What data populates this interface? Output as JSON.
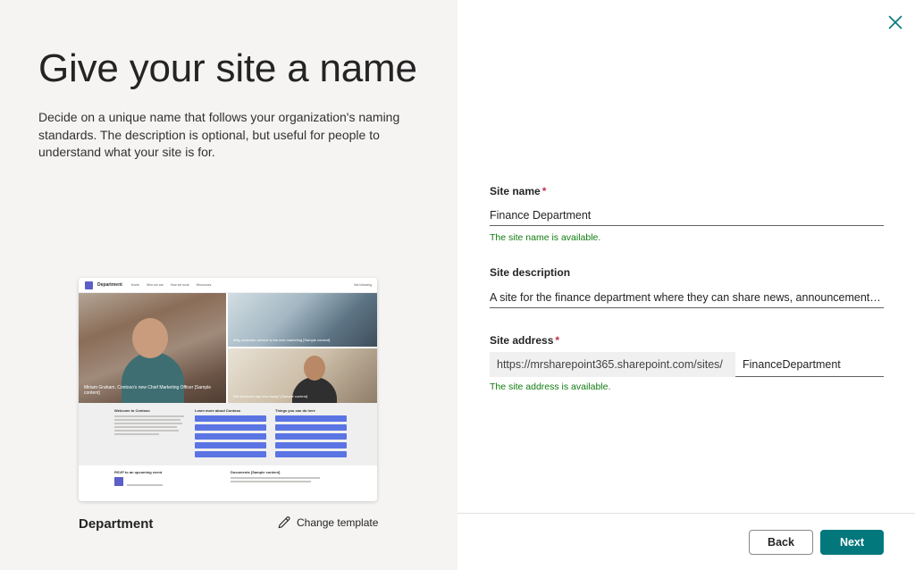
{
  "left": {
    "title": "Give your site a name",
    "description": "Decide on a unique name that follows your organization's naming standards. The description is optional, but useful for people to understand what your site is for.",
    "template_name": "Department",
    "change_template_label": "Change template",
    "preview": {
      "site_name": "Department",
      "nav": [
        "Home",
        "Who we are",
        "How we work",
        "Resources"
      ],
      "follow": "Not following",
      "hero_main_caption": "Miriam Graham, Contoso's new Chief Marketing Officer [Sample content]",
      "hero_top_caption": "Why customer service is the new marketing [Sample content]",
      "hero_bottom_caption": "Did someone say new swag? [Sample content]",
      "welcome_title": "Welcome to Contoso",
      "learn_title": "Learn more about Contoso",
      "things_title": "Things you can do here",
      "rsvp_title": "RSVP to an upcoming event",
      "documents_title": "Documents [Sample content]"
    }
  },
  "form": {
    "site_name_label": "Site name",
    "site_name_value": "Finance Department",
    "site_name_status": "The site name is available.",
    "description_label": "Site description",
    "description_value": "A site for the finance department where they can share news, announcements and resources.",
    "address_label": "Site address",
    "address_prefix": "https://mrsharepoint365.sharepoint.com/sites/",
    "address_value": "FinanceDepartment",
    "address_status": "The site address is available.",
    "required_mark": "*"
  },
  "footer": {
    "back_label": "Back",
    "next_label": "Next"
  },
  "colors": {
    "primary": "#03787c",
    "success": "#107c10",
    "required": "#c4314b",
    "left_bg": "#f5f4f3"
  },
  "icons": {
    "close": "close-icon",
    "edit": "pencil-icon"
  }
}
